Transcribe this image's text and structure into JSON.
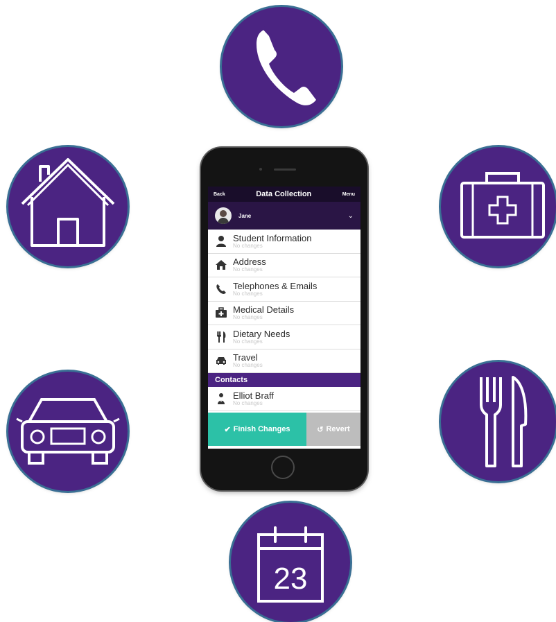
{
  "colors": {
    "circle": "#4b2482",
    "circle_border": "#3a6f94",
    "nav": "#190d2a",
    "header": "#2a1545",
    "contacts": "#4b2482",
    "finish": "#2cc1a7",
    "revert": "#bdbdbd"
  },
  "circle_icons": {
    "top": "phone-icon",
    "left_top": "house-icon",
    "right_top": "medical-kit-icon",
    "left_bottom": "car-icon",
    "right_bottom": "fork-knife-icon",
    "bottom": "calendar-icon",
    "calendar_day": "23"
  },
  "app": {
    "nav": {
      "back": "Back",
      "title": "Data Collection",
      "menu": "Menu"
    },
    "user": {
      "name": "Jane",
      "chevron": "⌄"
    },
    "items": [
      {
        "label": "Student Information",
        "status": "No changes",
        "icon": "person-icon"
      },
      {
        "label": "Address",
        "status": "No changes",
        "icon": "home-icon"
      },
      {
        "label": "Telephones & Emails",
        "status": "No changes",
        "icon": "phone-icon"
      },
      {
        "label": "Medical Details",
        "status": "No changes",
        "icon": "medical-icon"
      },
      {
        "label": "Dietary Needs",
        "status": "No changes",
        "icon": "utensils-icon"
      },
      {
        "label": "Travel",
        "status": "No changes",
        "icon": "car-icon"
      }
    ],
    "contacts_header": "Contacts",
    "contacts": [
      {
        "label": "Elliot Braff",
        "status": "No changes",
        "icon": "contact-icon"
      }
    ],
    "actions": {
      "finish": "Finish Changes",
      "finish_symbol": "✔",
      "revert": "Revert",
      "revert_symbol": "↺"
    }
  }
}
